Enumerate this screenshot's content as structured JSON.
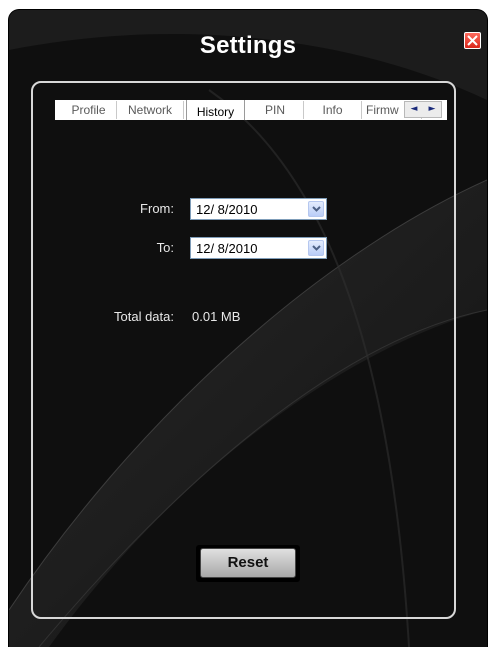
{
  "window": {
    "title": "Settings"
  },
  "tabs": [
    {
      "label": "Profile"
    },
    {
      "label": "Network"
    },
    {
      "label": "History"
    },
    {
      "label": "PIN"
    },
    {
      "label": "Info"
    },
    {
      "label": "Firmw"
    }
  ],
  "active_tab": "History",
  "tab_scroll": {
    "left": "◄",
    "right": "►"
  },
  "history": {
    "from_label": "From:",
    "from_value": "12/ 8/2010",
    "to_label": "To:",
    "to_value": "12/ 8/2010",
    "total_label": "Total data:",
    "total_value": "0.01 MB"
  },
  "reset_label": "Reset",
  "colors": {
    "background": "#0e0e0e",
    "panel_border": "#d8d8d8",
    "active_tab_accent": "#f2a93b",
    "close_button": "#d9261a"
  },
  "icons": {
    "close": "close-icon",
    "dropdown": "chevron-down-icon"
  }
}
